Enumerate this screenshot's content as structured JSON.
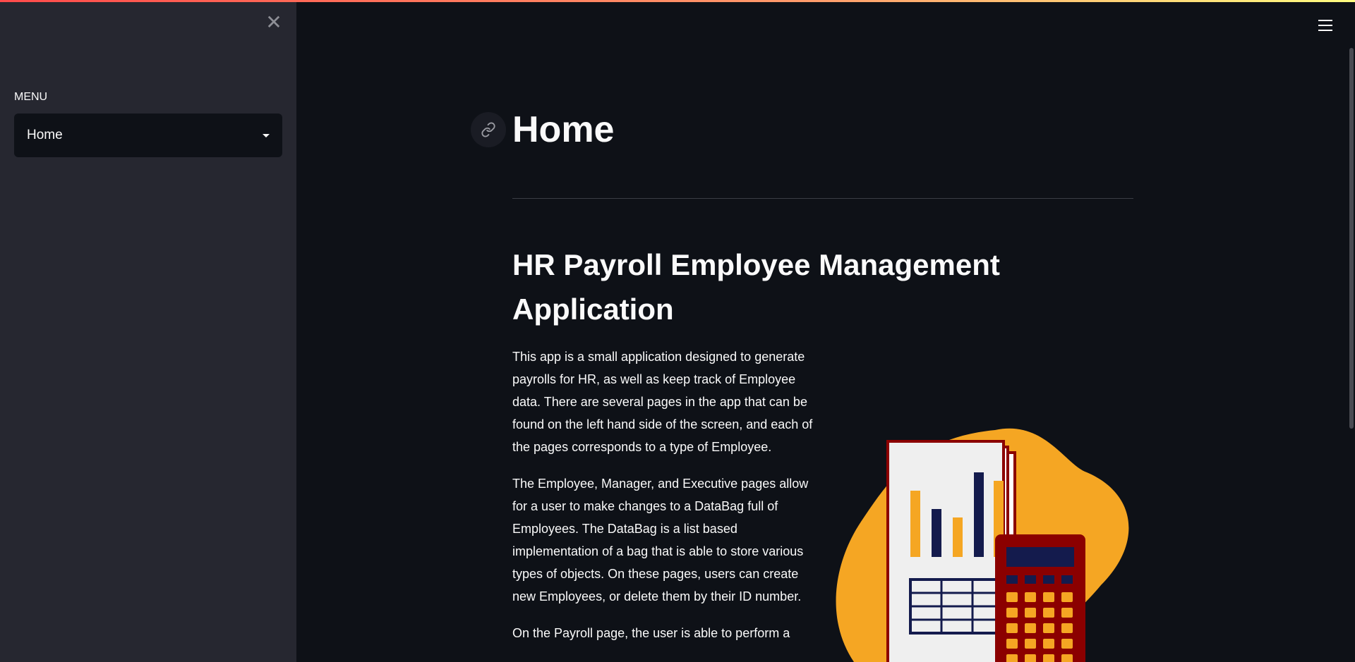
{
  "sidebar": {
    "menu_label": "MENU",
    "select_value": "Home"
  },
  "main": {
    "page_title": "Home",
    "heading": "HR Payroll Employee Management Application",
    "paragraphs": [
      "This app is a small application designed to generate payrolls for HR, as well as keep track of Employee data. There are several pages in the app that can be found on the left hand side of the screen, and each of the pages corresponds to a type of Employee.",
      "The Employee, Manager, and Executive pages allow for a user to make changes to a DataBag full of Employees. The DataBag is a list based implementation of a bag that is able to store various types of objects. On these pages, users can create new Employees, or delete them by their ID number.",
      "On the Payroll page, the user is able to perform a"
    ]
  },
  "colors": {
    "background": "#0e1117",
    "sidebar": "#262730",
    "accent_orange": "#f5a623",
    "accent_navy": "#141b4d",
    "accent_red": "#8b0000"
  }
}
